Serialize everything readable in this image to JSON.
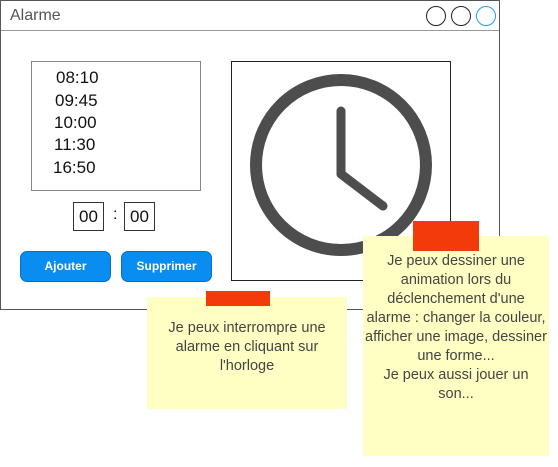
{
  "window": {
    "title": "Alarme",
    "controls": [
      "minimize",
      "maximize",
      "close"
    ]
  },
  "alarms": [
    "08:10",
    "09:45",
    "10:00",
    "11:30",
    "16:50"
  ],
  "time_input": {
    "hours": "00",
    "separator": ":",
    "minutes": "00"
  },
  "buttons": {
    "add_label": "Ajouter",
    "delete_label": "Supprimer"
  },
  "clock": {
    "icon": "clock-icon",
    "color": "#4d4d4d"
  },
  "notes": [
    {
      "text": "Je peux interrompre une alarme en cliquant sur l'horloge"
    },
    {
      "text": "Je peux dessiner une animation lors du déclenchement d'une alarme : changer la couleur, afficher une image, dessiner une forme...\nJe peux aussi jouer un son..."
    }
  ],
  "colors": {
    "accent": "#0a8df0",
    "note": "#ffffc4",
    "tape": "#f23a0a"
  }
}
